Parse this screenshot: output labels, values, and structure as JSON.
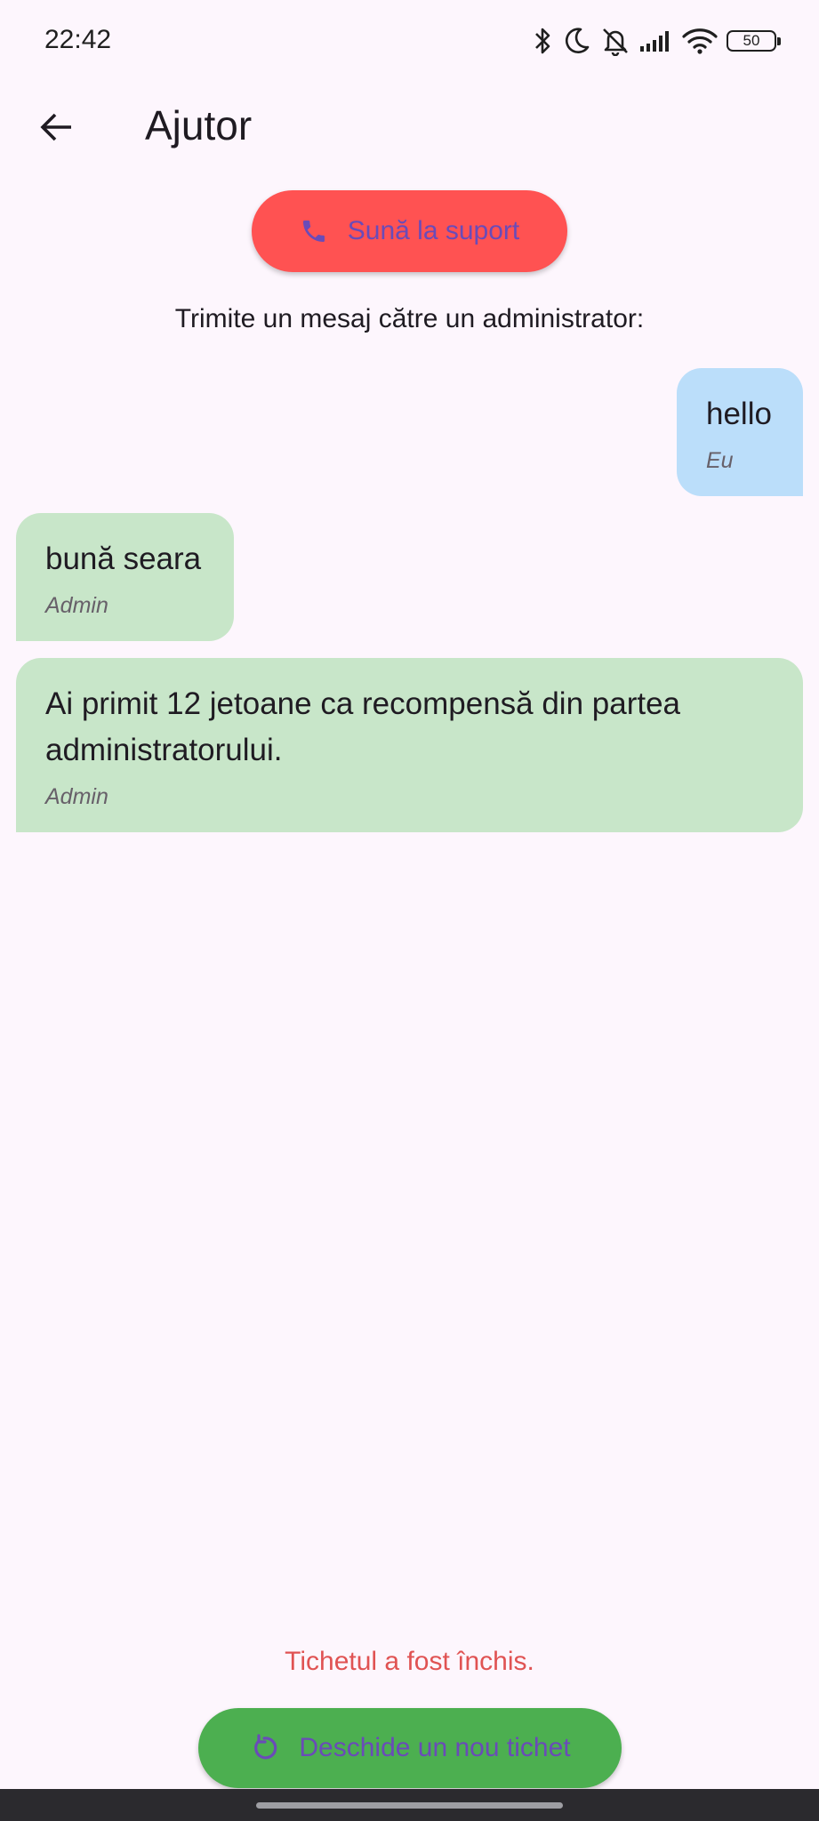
{
  "status_bar": {
    "time": "22:42",
    "battery": "50",
    "icons": [
      "bluetooth-icon",
      "do-not-disturb-moon-icon",
      "bell-off-icon",
      "signal-icon",
      "wifi-icon",
      "battery-icon"
    ]
  },
  "app_bar": {
    "back_icon": "arrow-left-icon",
    "title": "Ajutor"
  },
  "call_support": {
    "icon": "phone-icon",
    "label": "Sună la suport",
    "bg_color": "#ff5252",
    "text_color": "#6a4bb8"
  },
  "instruction": "Trimite un mesaj către un administrator:",
  "messages": [
    {
      "text": "hello",
      "sender": "Eu",
      "bg_color": "#bbdefa"
    },
    {
      "text": "bună seara",
      "sender": "Admin",
      "bg_color": "#c8e6c9"
    },
    {
      "text": "Ai primit 12 jetoane ca recompensă din partea administratorului.",
      "sender": "Admin",
      "bg_color": "#c8e6c9"
    }
  ],
  "ticket_status": "Tichetul a fost închis.",
  "new_ticket": {
    "icon": "refresh-icon",
    "label": "Deschide un nou tichet",
    "bg_color": "#4caf50"
  }
}
